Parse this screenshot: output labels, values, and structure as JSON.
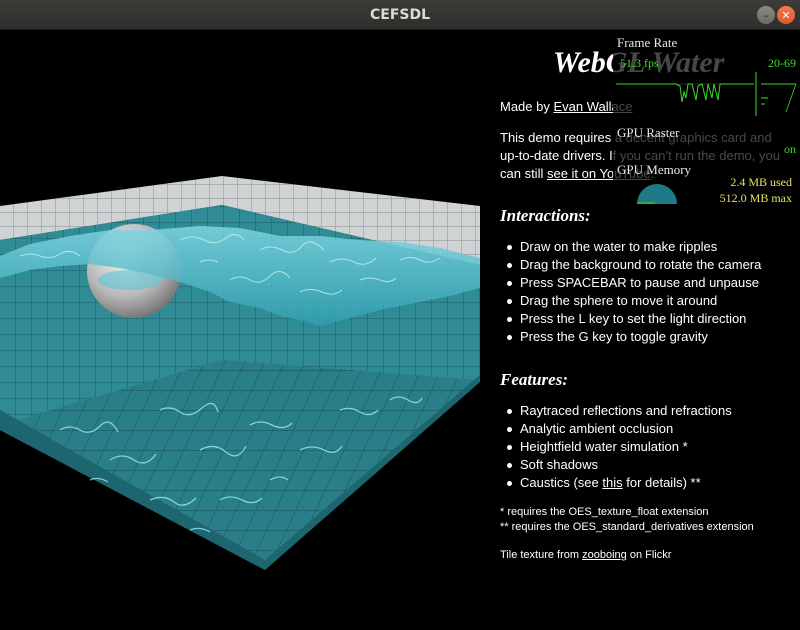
{
  "window": {
    "title": "CEFSDL",
    "minimize_icon": "minimize-icon",
    "close_icon": "close-icon"
  },
  "page": {
    "title": "WebGL Water",
    "author_prefix": "Made by ",
    "author_link": "Evan Wallace",
    "requirements_text": "This demo requires a decent graphics card and up-to-date drivers. If you can't run the demo, you can still ",
    "youtube_link": "see it on YouTube",
    "requirements_end": ".",
    "interactions_heading": "Interactions:",
    "interactions": [
      "Draw on the water to make ripples",
      "Drag the background to rotate the camera",
      "Press SPACEBAR to pause and unpause",
      "Drag the sphere to move it around",
      "Press the L key to set the light direction",
      "Press the G key to toggle gravity"
    ],
    "features_heading": "Features:",
    "features": [
      "Raytraced reflections and refractions",
      "Analytic ambient occlusion",
      "Heightfield water simulation *",
      "Soft shadows"
    ],
    "caustics_prefix": "Caustics (see ",
    "caustics_link": "this",
    "caustics_suffix": " for details) **",
    "footnote1": "* requires the OES_texture_float extension",
    "footnote2": "** requires the OES_standard_derivatives extension",
    "tile_prefix": "Tile texture from ",
    "tile_link": "zooboing",
    "tile_suffix": " on Flickr"
  },
  "hud": {
    "frame_rate_label": "Frame Rate",
    "fps_value": "51.3 fps",
    "fps_range": "20-69",
    "gpu_raster_label": "GPU Raster",
    "gpu_raster_value": "on",
    "gpu_memory_label": "GPU Memory",
    "memory_used": "2.4 MB used",
    "memory_max": "512.0 MB max"
  },
  "colors": {
    "water": "#2a8fa0",
    "tile": "#3a9ea8",
    "hud_green": "#3bdc2a",
    "hud_yellow": "#e8e060",
    "gauge": "#1e7a86"
  }
}
